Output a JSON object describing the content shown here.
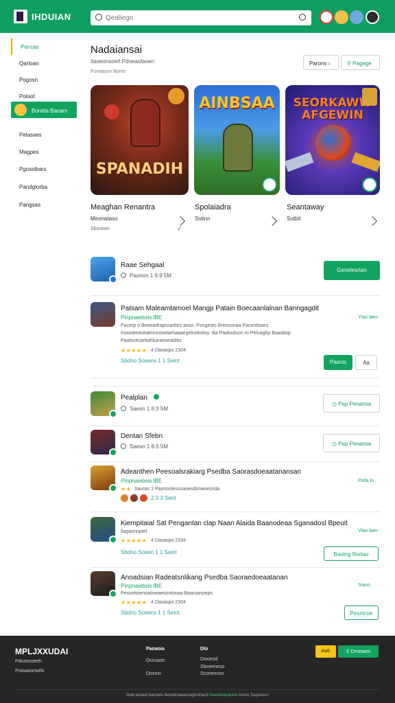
{
  "header": {
    "brand": "IHDUIAN",
    "search_placeholder": "Qealiego",
    "icons": [
      "notifications-icon",
      "rewards-icon",
      "avatar",
      "account-icon"
    ]
  },
  "sidebar": {
    "items": [
      {
        "label": "Pencas",
        "state": "highlighted"
      },
      {
        "label": "Qarloan"
      },
      {
        "label": "Pogosn"
      },
      {
        "label": "Poloot"
      },
      {
        "label": "Bonlda Banam",
        "state": "active"
      },
      {
        "label": "Pelasaes"
      },
      {
        "label": "Magpes"
      },
      {
        "label": "Pgosslbars"
      },
      {
        "label": "Pandglorba"
      },
      {
        "label": "Pangsas"
      }
    ]
  },
  "page": {
    "title": "Nadaiansai",
    "subtitle": "Ilaoeonsoerl Pdoeasfaoen",
    "meta": "Pontalsen Bonts",
    "btn_filter": "Parons",
    "btn_share": "Pagege"
  },
  "featured": [
    {
      "art_title": "SPANADIH",
      "name": "Meaghan Renantra",
      "sub": "Meonataso",
      "sub2": "Sbsoean"
    },
    {
      "art_title": "AINBSAA",
      "name": "Spolaiadra",
      "sub": "Sotinn",
      "sub2": ""
    },
    {
      "art_title": "SEORKAWW AFGEWIN",
      "name": "Seantaway",
      "sub": "Sotbit",
      "sub2": ""
    }
  ],
  "list": [
    {
      "title": "Raae Sehgaal",
      "meta": "Paorion 1 8.9 5M",
      "button": "Genelesrian"
    },
    {
      "title": "Patsam Maleamtamoel Mangp Patain Boecaanlalnan Banngagdit",
      "green": "Pinpnaiebsis lBE",
      "desc1": "Pacerp o Beoeadrapcoarttes aoso: Pongesto Breoconaa Pacontisses",
      "desc2": "Inoooeeaoealmnsooeiarhaaaegelcebslioy: Ba Paobsdson ro Peluaghp Baasbop",
      "desc3": "Paatscecarttahbaraosealdes",
      "rating": "4 Dasaspo 2304",
      "tags": "Sbdno Sosens 1 1 Seint",
      "side": "Ylao laen",
      "button": "Pasnis",
      "button2": "Aa"
    },
    {
      "title": "Pealplan",
      "meta": "Saesn 1 8.9 5M",
      "button": "Pap Penansa"
    },
    {
      "title": "Dentan Sfebn",
      "meta": "Saesn 1 8.5 5M",
      "button": "Pap Penansa"
    },
    {
      "title": "Adeanthen Peesoalsrakiarg Psedba Saorasdoeaatanansan",
      "green": "Pinpnaiebsis lBE",
      "desc1": "Sauras 1 Paonostesosaoesdonaoesnda",
      "tags": "2.3 3 Sent",
      "side": "Piela ln"
    },
    {
      "title": "Kiempitaial Sat Pengantan clap Naan Alaida Baanodeaa Sganadosl Bpeuit",
      "green": "Ilagaonoptet",
      "rating": "4 Dasaspo 2334",
      "tags": "Sbdno Sosen 1 1 Seint",
      "side": "Vlao laen",
      "button": "Bastng Rorlao"
    },
    {
      "title": "Anoadsian Radeatsnlikang Psedba Saoraedoeaatanan",
      "green": "Pinpnaiebsis lBE",
      "desc1": "Pessetotenoatioeaesontonaa Baarsanoeps",
      "rating": "4 Dasaspo 2304",
      "tags": "Sbdno Sosens 1 1 Seint",
      "side": "Siaoo",
      "button": "Pesnicoe"
    }
  ],
  "footer": {
    "brand": "MPLJXXUDAI",
    "left_lines": [
      "Pdosesoeeh",
      "Prasaoonsels"
    ],
    "col1_head": "Paoaoia",
    "col1": [
      "Dsnsaon",
      "Dosnio"
    ],
    "col2_head": "Dlo",
    "col2": [
      "Dwoesd",
      "Sboeeneso",
      "Sconesnos"
    ],
    "btn_yellow": "Aab",
    "btn_green": "Drnetaen",
    "copyright": "Bolb laniaoi bannels Aeosbinaaeroagnolnacb",
    "copyright_green": "Seeotieaoanleo",
    "copyright_tail": "Ienso Sapsosen"
  },
  "colors": {
    "brand_green": "#0e9e5f",
    "accent_yellow": "#f0a500",
    "footer_bg": "#262626"
  }
}
